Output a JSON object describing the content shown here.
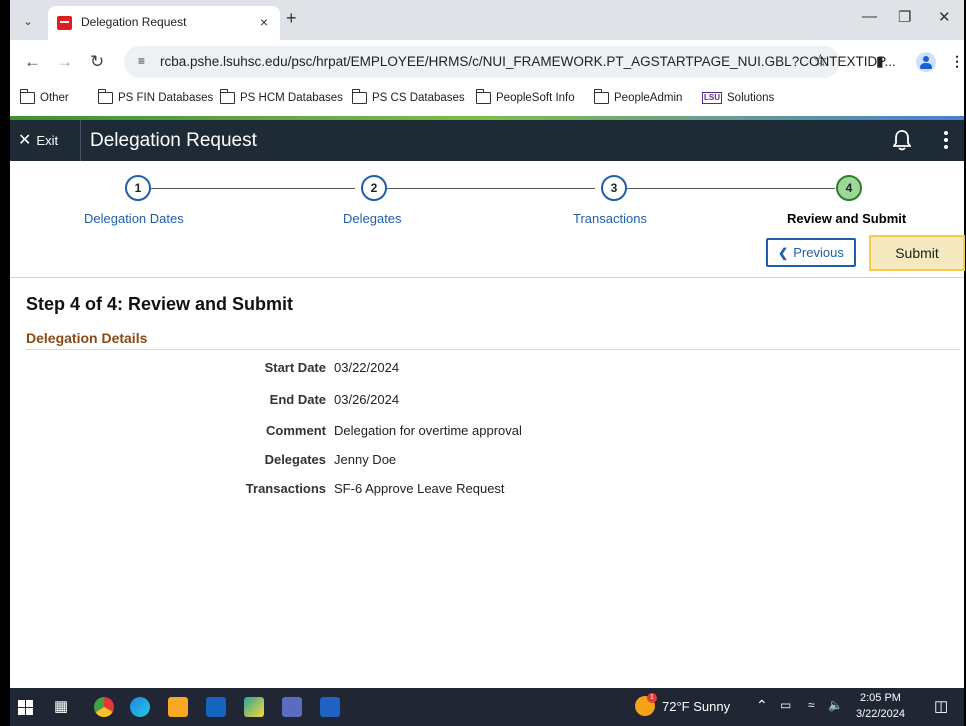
{
  "browser": {
    "tab_title": "Delegation Request",
    "tab_close": "×",
    "new_tab": "+",
    "url": "rcba.pshe.lsuhsc.edu/psc/hrpat/EMPLOYEE/HRMS/c/NUI_FRAMEWORK.PT_AGSTARTPAGE_NUI.GBL?CONTEXTIDP...",
    "bookmarks": [
      "Other",
      "PS FIN Databases",
      "PS HCM Databases",
      "PS CS Databases",
      "PeopleSoft Info",
      "PeopleAdmin",
      "Solutions"
    ],
    "lsu_badge": "LSU"
  },
  "app": {
    "exit_label": "Exit",
    "title": "Delegation Request"
  },
  "steps": [
    {
      "number": "1",
      "label": "Delegation Dates"
    },
    {
      "number": "2",
      "label": "Delegates"
    },
    {
      "number": "3",
      "label": "Transactions"
    },
    {
      "number": "4",
      "label": "Review and Submit"
    }
  ],
  "active_step": 4,
  "buttons": {
    "previous": "Previous",
    "submit": "Submit"
  },
  "content": {
    "step_title": "Step 4 of 4: Review and Submit",
    "section_title": "Delegation Details",
    "details": [
      {
        "label": "Start Date",
        "value": "03/22/2024"
      },
      {
        "label": "End Date",
        "value": "03/26/2024"
      },
      {
        "label": "Comment",
        "value": "Delegation for overtime approval"
      },
      {
        "label": "Delegates",
        "value": "Jenny Doe"
      },
      {
        "label": "Transactions",
        "value": "SF-6 Approve Leave Request"
      }
    ]
  },
  "taskbar": {
    "weather": "72°F  Sunny",
    "time": "2:05 PM",
    "date": "3/22/2024",
    "weather_badge": "1"
  },
  "colors": {
    "header_bg": "#1f2a37",
    "link_blue": "#1f5fa9",
    "section_brown": "#8a4a14",
    "active_step": "#9ed79a",
    "submit_bg": "#f6e9bf"
  }
}
